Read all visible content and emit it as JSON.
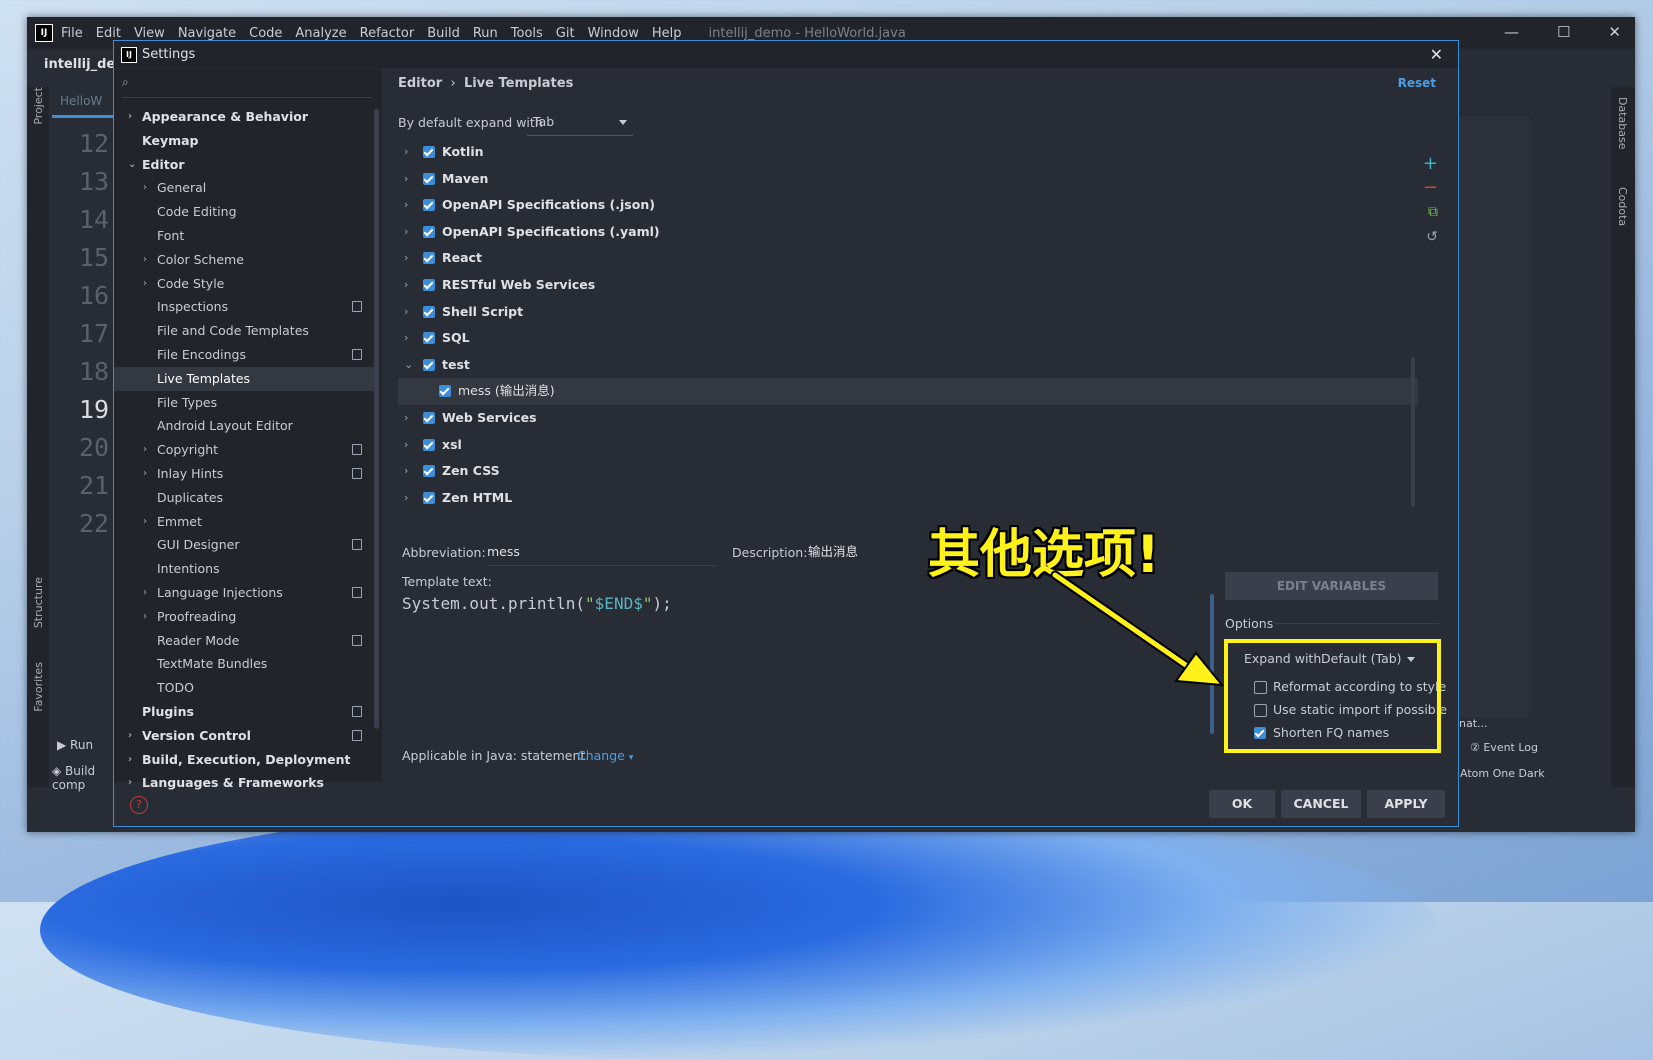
{
  "ide": {
    "menu": [
      "File",
      "Edit",
      "View",
      "Navigate",
      "Code",
      "Analyze",
      "Refactor",
      "Build",
      "Run",
      "Tools",
      "Git",
      "Window",
      "Help"
    ],
    "title": "intellij_demo - HelloWorld.java",
    "project_name": "intellij_demo",
    "tab_label": "HelloW",
    "line_numbers": [
      "12",
      "13",
      "14",
      "15",
      "16",
      "17",
      "18",
      "19",
      "20",
      "21",
      "22"
    ],
    "current_line": "19",
    "tool_project": "Project",
    "tool_structure": "Structure",
    "tool_favorites": "Favorites",
    "tool_database": "Database",
    "tool_codota": "Codota",
    "run_label": "Run",
    "build_label": "Build comp",
    "event_log": "Event Log",
    "theme": "Atom One Dark",
    "panel_text": "nat..."
  },
  "dialog": {
    "title": "Settings",
    "search_placeholder": "",
    "breadcrumb_parent": "Editor",
    "breadcrumb_current": "Live Templates",
    "reset_label": "Reset",
    "expand_label": "By default expand with",
    "expand_value": "Tab",
    "tree": [
      {
        "label": "Appearance & Behavior",
        "bold": true,
        "arrow": "right",
        "indent": 0
      },
      {
        "label": "Keymap",
        "bold": true,
        "arrow": "",
        "indent": 0
      },
      {
        "label": "Editor",
        "bold": true,
        "arrow": "down",
        "indent": 0
      },
      {
        "label": "General",
        "bold": false,
        "arrow": "right",
        "indent": 1
      },
      {
        "label": "Code Editing",
        "bold": false,
        "arrow": "",
        "indent": 1
      },
      {
        "label": "Font",
        "bold": false,
        "arrow": "",
        "indent": 1
      },
      {
        "label": "Color Scheme",
        "bold": false,
        "arrow": "right",
        "indent": 1
      },
      {
        "label": "Code Style",
        "bold": false,
        "arrow": "right",
        "indent": 1
      },
      {
        "label": "Inspections",
        "bold": false,
        "arrow": "",
        "indent": 1,
        "icon": true
      },
      {
        "label": "File and Code Templates",
        "bold": false,
        "arrow": "",
        "indent": 1
      },
      {
        "label": "File Encodings",
        "bold": false,
        "arrow": "",
        "indent": 1,
        "icon": true
      },
      {
        "label": "Live Templates",
        "bold": false,
        "arrow": "",
        "indent": 1,
        "selected": true
      },
      {
        "label": "File Types",
        "bold": false,
        "arrow": "",
        "indent": 1
      },
      {
        "label": "Android Layout Editor",
        "bold": false,
        "arrow": "",
        "indent": 1
      },
      {
        "label": "Copyright",
        "bold": false,
        "arrow": "right",
        "indent": 1,
        "icon": true
      },
      {
        "label": "Inlay Hints",
        "bold": false,
        "arrow": "right",
        "indent": 1,
        "icon": true
      },
      {
        "label": "Duplicates",
        "bold": false,
        "arrow": "",
        "indent": 1
      },
      {
        "label": "Emmet",
        "bold": false,
        "arrow": "right",
        "indent": 1
      },
      {
        "label": "GUI Designer",
        "bold": false,
        "arrow": "",
        "indent": 1,
        "icon": true
      },
      {
        "label": "Intentions",
        "bold": false,
        "arrow": "",
        "indent": 1
      },
      {
        "label": "Language Injections",
        "bold": false,
        "arrow": "right",
        "indent": 1,
        "icon": true
      },
      {
        "label": "Proofreading",
        "bold": false,
        "arrow": "right",
        "indent": 1
      },
      {
        "label": "Reader Mode",
        "bold": false,
        "arrow": "",
        "indent": 1,
        "icon": true
      },
      {
        "label": "TextMate Bundles",
        "bold": false,
        "arrow": "",
        "indent": 1
      },
      {
        "label": "TODO",
        "bold": false,
        "arrow": "",
        "indent": 1
      },
      {
        "label": "Plugins",
        "bold": true,
        "arrow": "",
        "indent": 0,
        "icon": true
      },
      {
        "label": "Version Control",
        "bold": true,
        "arrow": "right",
        "indent": 0,
        "icon": true
      },
      {
        "label": "Build, Execution, Deployment",
        "bold": true,
        "arrow": "right",
        "indent": 0
      },
      {
        "label": "Languages & Frameworks",
        "bold": true,
        "arrow": "right",
        "indent": 0
      }
    ],
    "templates": [
      {
        "label": "Kotlin",
        "arrow": "right",
        "checked": true
      },
      {
        "label": "Maven",
        "arrow": "right",
        "checked": true
      },
      {
        "label": "OpenAPI Specifications (.json)",
        "arrow": "right",
        "checked": true
      },
      {
        "label": "OpenAPI Specifications (.yaml)",
        "arrow": "right",
        "checked": true
      },
      {
        "label": "React",
        "arrow": "right",
        "checked": true
      },
      {
        "label": "RESTful Web Services",
        "arrow": "right",
        "checked": true
      },
      {
        "label": "Shell Script",
        "arrow": "right",
        "checked": true
      },
      {
        "label": "SQL",
        "arrow": "right",
        "checked": true
      },
      {
        "label": "test",
        "arrow": "down",
        "checked": true
      },
      {
        "label": "mess (输出消息)",
        "arrow": "",
        "checked": true,
        "child": true
      },
      {
        "label": "Web Services",
        "arrow": "right",
        "checked": true
      },
      {
        "label": "xsl",
        "arrow": "right",
        "checked": true
      },
      {
        "label": "Zen CSS",
        "arrow": "right",
        "checked": true
      },
      {
        "label": "Zen HTML",
        "arrow": "right",
        "checked": true
      }
    ],
    "abbreviation_label": "Abbreviation:",
    "abbreviation_value": "mess",
    "description_label": "Description:",
    "description_value": "输出消息",
    "template_text_label": "Template text:",
    "code_prefix": "System.out.println(",
    "code_string_open": "\"",
    "code_var": "$END$",
    "code_string_close": "\"",
    "code_suffix": ");",
    "applicable_text": "Applicable in Java: statement.",
    "change_label": "Change",
    "edit_variables_label": "EDIT VARIABLES",
    "options_label": "Options",
    "options_expand_label": "Expand with",
    "options_expand_value": "Default (Tab)",
    "options": [
      {
        "label": "Reformat according to style",
        "checked": false
      },
      {
        "label": "Use static import if possible",
        "checked": false
      },
      {
        "label": "Shorten FQ names",
        "checked": true
      }
    ],
    "ok_label": "OK",
    "cancel_label": "CANCEL",
    "apply_label": "APPLY",
    "help_icon": "?"
  },
  "annotation": {
    "text": "其他选项!",
    "color": "#fff21a"
  },
  "colors": {
    "accent": "#3d8dd8",
    "link": "#4a9fe8",
    "background": "#282c34"
  }
}
